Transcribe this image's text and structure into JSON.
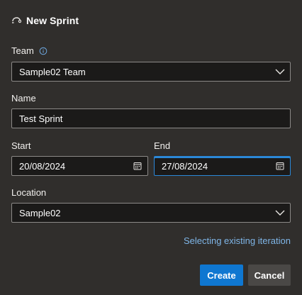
{
  "dialog": {
    "title": "New Sprint",
    "title_icon": "sprint-icon"
  },
  "team": {
    "label": "Team",
    "info_icon": "info-icon",
    "value": "Sample02 Team"
  },
  "name": {
    "label": "Name",
    "value": "Test Sprint"
  },
  "start": {
    "label": "Start",
    "value": "20/08/2024"
  },
  "end": {
    "label": "End",
    "value": "27/08/2024"
  },
  "location": {
    "label": "Location",
    "value": "Sample02"
  },
  "link_text": "Selecting existing iteration",
  "buttons": {
    "create": "Create",
    "cancel": "Cancel"
  },
  "colors": {
    "background": "#302e2c",
    "primary": "#0f77d1",
    "link": "#7fb6e8",
    "focus": "#2b88d8"
  }
}
